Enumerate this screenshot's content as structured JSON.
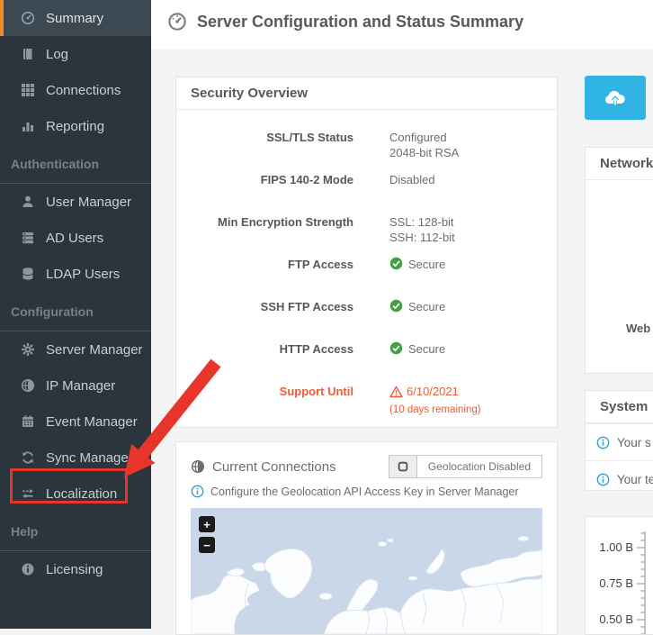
{
  "colors": {
    "sidebar_bg": "#2b353d",
    "sidebar_active_bg": "#3d4952",
    "accent_orange": "#ee8b23",
    "annotation_red": "#e8352b",
    "status_green": "#43a047",
    "warning_orange": "#ed5b35",
    "info_blue": "#2f9bd6",
    "primary_cyan": "#30b4e4",
    "map_ocean": "#c9d7e8"
  },
  "header": {
    "title": "Server Configuration and Status Summary"
  },
  "sidebar": {
    "items": [
      {
        "label": "Summary",
        "icon": "gauge-icon",
        "active": true
      },
      {
        "label": "Log",
        "icon": "book-icon"
      },
      {
        "label": "Connections",
        "icon": "grid-icon"
      },
      {
        "label": "Reporting",
        "icon": "bar-chart-icon"
      },
      {
        "label": "User Manager",
        "icon": "user-icon"
      },
      {
        "label": "AD Users",
        "icon": "server-stack-icon"
      },
      {
        "label": "LDAP Users",
        "icon": "database-icon"
      },
      {
        "label": "Server Manager",
        "icon": "gear-icon"
      },
      {
        "label": "IP Manager",
        "icon": "globe-icon"
      },
      {
        "label": "Event Manager",
        "icon": "calendar-icon"
      },
      {
        "label": "Sync Manager",
        "icon": "sync-icon"
      },
      {
        "label": "Localization",
        "icon": "swap-arrows-icon"
      },
      {
        "label": "Licensing",
        "icon": "info-circle-icon"
      }
    ],
    "sections": [
      "Authentication",
      "Configuration",
      "Help"
    ]
  },
  "security": {
    "title": "Security Overview",
    "rows": [
      {
        "label": "SSL/TLS Status",
        "lines": [
          "Configured",
          "2048-bit RSA"
        ]
      },
      {
        "label": "FIPS 140-2 Mode",
        "lines": [
          "Disabled"
        ]
      },
      {
        "label": "Min Encryption Strength",
        "lines": [
          "SSL: 128-bit",
          "SSH: 112-bit"
        ]
      },
      {
        "label": "FTP Access",
        "status": "Secure"
      },
      {
        "label": "SSH FTP Access",
        "status": "Secure"
      },
      {
        "label": "HTTP Access",
        "status": "Secure"
      }
    ],
    "support": {
      "label": "Support Until",
      "date": "6/10/2021",
      "note": "(10 days remaining)"
    }
  },
  "connections": {
    "title": "Current Connections",
    "geolocation_button": "Geolocation Disabled",
    "note": "Configure the Geolocation API Access Key in Server Manager",
    "zoom_in": "+",
    "zoom_out": "−"
  },
  "right": {
    "network_title": "Network",
    "web_label": "Web",
    "system_title": "System",
    "system_rows": [
      "Your s",
      "Your te"
    ],
    "chart_axis_labels": [
      "1.00 B",
      "0.75 B",
      "0.50 B"
    ]
  }
}
